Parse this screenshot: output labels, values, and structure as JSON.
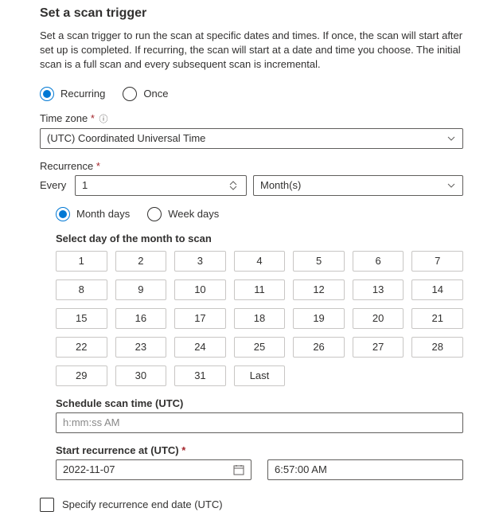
{
  "title": "Set a scan trigger",
  "description": "Set a scan trigger to run the scan at specific dates and times. If once, the scan will start after set up is completed. If recurring, the scan will start at a date and time you choose. The initial scan is a full scan and every subsequent scan is incremental.",
  "triggerType": {
    "recurring": "Recurring",
    "once": "Once"
  },
  "timezone": {
    "label": "Time zone",
    "value": "(UTC) Coordinated Universal Time"
  },
  "recurrence": {
    "label": "Recurrence",
    "everyLabel": "Every",
    "everyValue": "1",
    "unit": "Month(s)",
    "monthDays": "Month days",
    "weekDays": "Week days",
    "selectDayTitle": "Select day of the month to scan",
    "days": [
      "1",
      "2",
      "3",
      "4",
      "5",
      "6",
      "7",
      "8",
      "9",
      "10",
      "11",
      "12",
      "13",
      "14",
      "15",
      "16",
      "17",
      "18",
      "19",
      "20",
      "21",
      "22",
      "23",
      "24",
      "25",
      "26",
      "27",
      "28",
      "29",
      "30",
      "31",
      "Last"
    ]
  },
  "scheduleTime": {
    "label": "Schedule scan time (UTC)",
    "placeholder": "h:mm:ss AM"
  },
  "startAt": {
    "label": "Start recurrence at (UTC)",
    "date": "2022-11-07",
    "time": "6:57:00 AM"
  },
  "endDate": {
    "label": "Specify recurrence end date (UTC)"
  }
}
